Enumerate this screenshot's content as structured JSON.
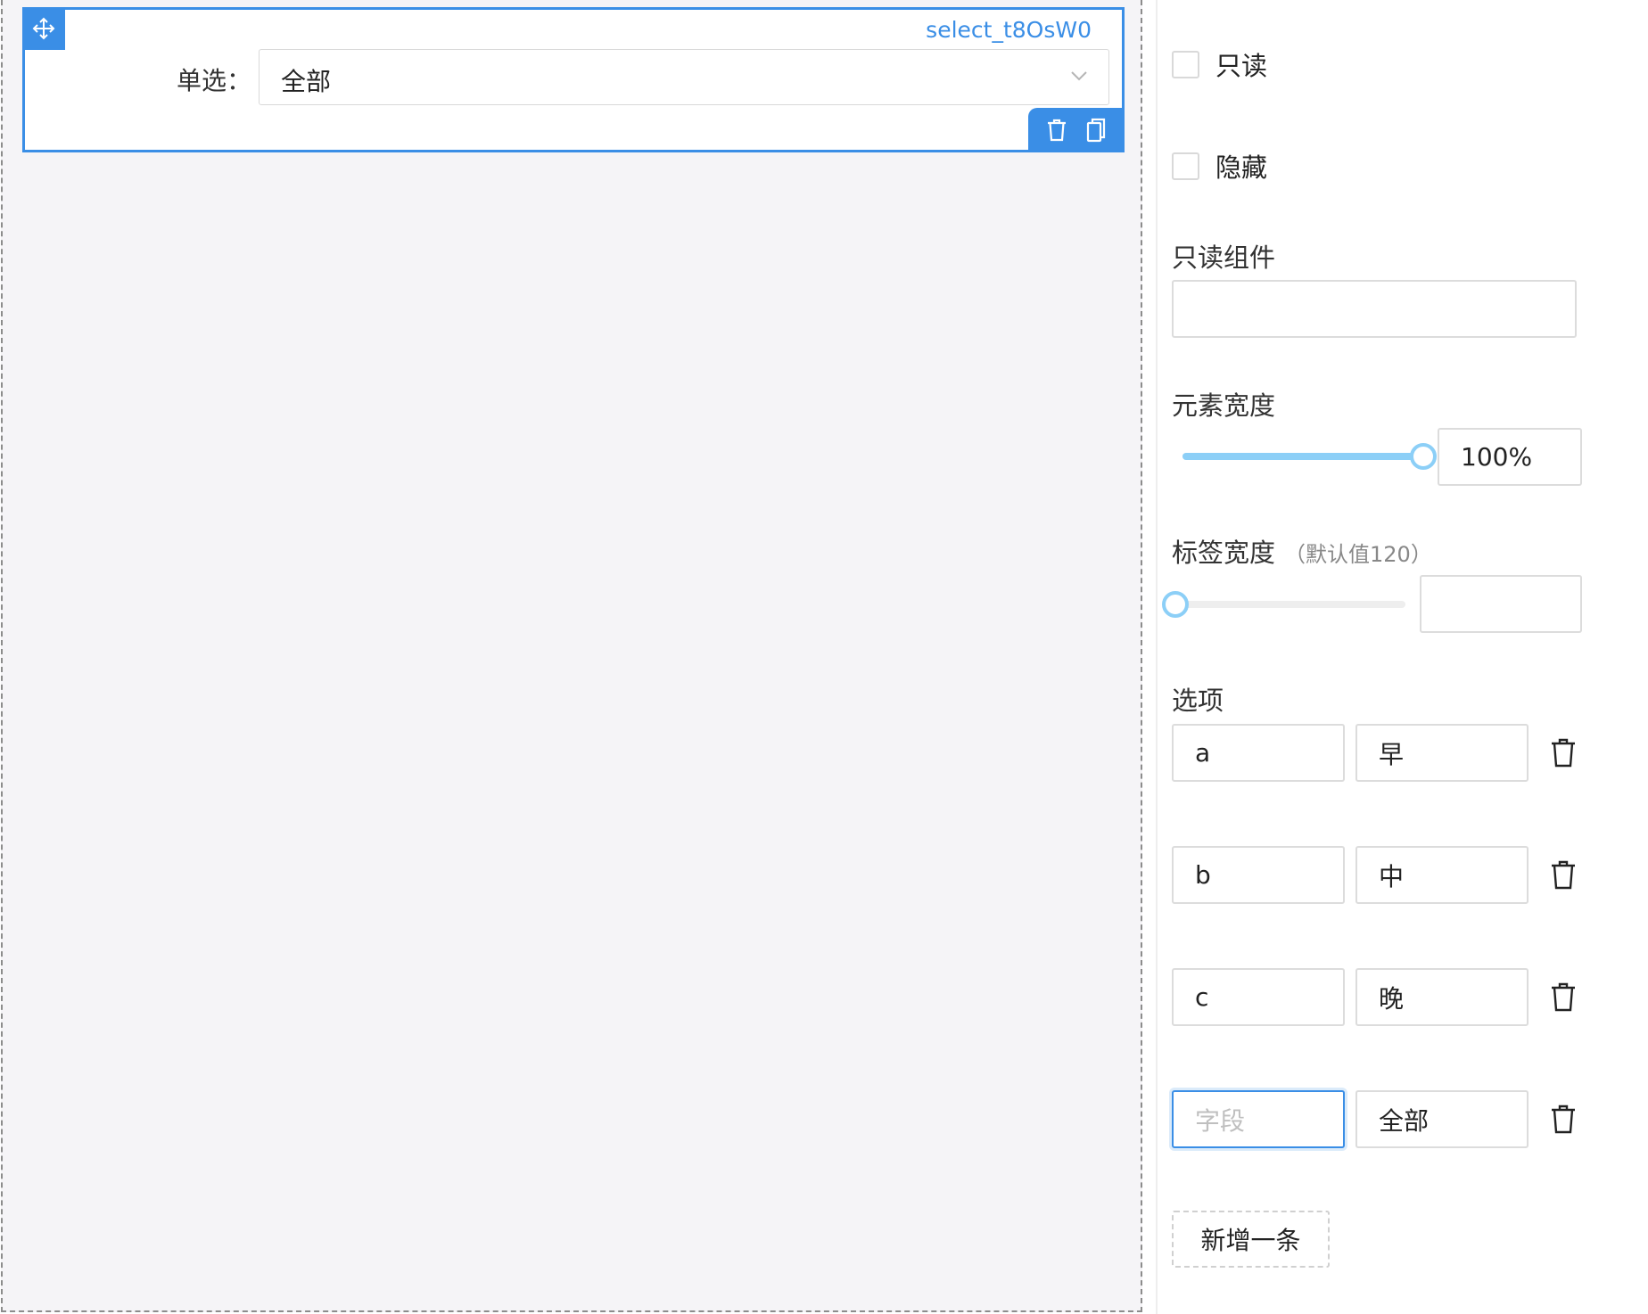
{
  "canvas": {
    "widget": {
      "id_label": "select_t8OsW0",
      "field_label": "单选：",
      "selected_value": "全部",
      "icons": {
        "drag": "move-icon",
        "arrow": "chevron-down-icon",
        "delete": "trash-icon",
        "copy": "copy-icon"
      }
    }
  },
  "panel": {
    "readonly_checkbox": {
      "label": "只读",
      "checked": false
    },
    "hidden_checkbox": {
      "label": "隐藏",
      "checked": false
    },
    "readonly_component": {
      "title": "只读组件",
      "value": ""
    },
    "element_width": {
      "title": "元素宽度",
      "value": "100%",
      "slider_percent": 100
    },
    "label_width": {
      "title": "标签宽度",
      "hint": "（默认值120）",
      "value": "",
      "slider_percent": 0
    },
    "options": {
      "title": "选项",
      "items": [
        {
          "key": "a",
          "label": "早"
        },
        {
          "key": "b",
          "label": "中"
        },
        {
          "key": "c",
          "label": "晚"
        },
        {
          "key": "",
          "key_placeholder": "字段",
          "label": "全部"
        }
      ],
      "add_button": "新增一条"
    }
  },
  "colors": {
    "accent": "#3a8ee6",
    "slider": "#8ccff7",
    "canvas_bg": "#f5f4f7"
  }
}
